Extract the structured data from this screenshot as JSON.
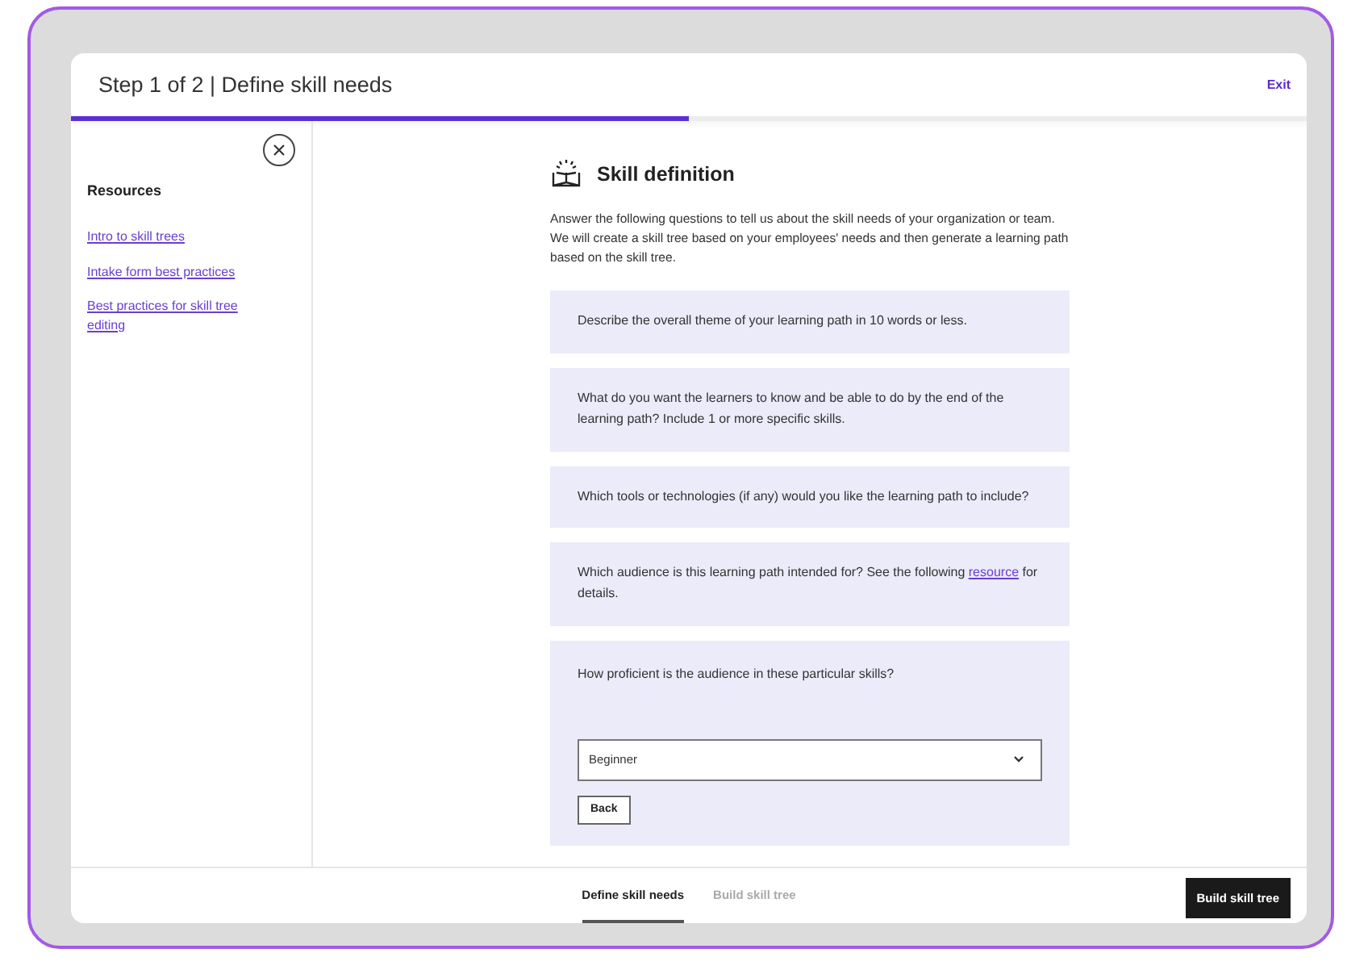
{
  "header": {
    "title": "Step 1 of 2 | Define skill needs",
    "exit": "Exit",
    "progress": {
      "level": 0.5
    }
  },
  "sidebar": {
    "heading": "Resources",
    "links": [
      "Intro to skill trees",
      "Intake form best practices",
      "Best practices for skill tree editing"
    ]
  },
  "main": {
    "title": "Skill definition",
    "intro": "Answer the following questions to tell us about the skill needs of your organization or team.  We will create a skill tree based on your employees' needs and then generate a learning path based on the skill tree.",
    "questions": [
      {
        "kind": "text",
        "text": "Describe the overall theme of your learning path in 10 words or less."
      },
      {
        "kind": "text",
        "text": "What do you want the learners to know and be able to do by the end of the learning path? Include 1 or more specific skills."
      },
      {
        "kind": "text",
        "text": "Which tools or technologies (if any) would you like the learning path to include?"
      },
      {
        "kind": "link",
        "text": "Which audience is this learning path intended for? See the following",
        "link": "resource",
        "after": "for details."
      },
      {
        "kind": "select",
        "text": "How proficient is the audience in these particular skills?",
        "value": "Beginner",
        "button": "Back"
      }
    ]
  },
  "footer": {
    "tabs": [
      {
        "label": "Define skill needs",
        "selected": true
      },
      {
        "label": "Build skill tree",
        "selected": false
      }
    ],
    "action": "Build skill tree"
  }
}
